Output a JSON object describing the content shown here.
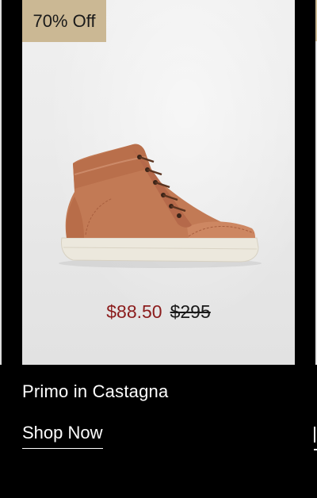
{
  "product": {
    "badge": "70% Off",
    "sale_price": "$88.50",
    "original_price": "$295",
    "title": "Primo in Castagna",
    "cta_label": "Shop Now",
    "image": "high-top-leather-sneaker-castagna"
  },
  "colors": {
    "background": "#000000",
    "badge": "#cbb894",
    "sale_price": "#8b1c1c",
    "leather": "#c27a55",
    "sole": "#ece8dd"
  }
}
